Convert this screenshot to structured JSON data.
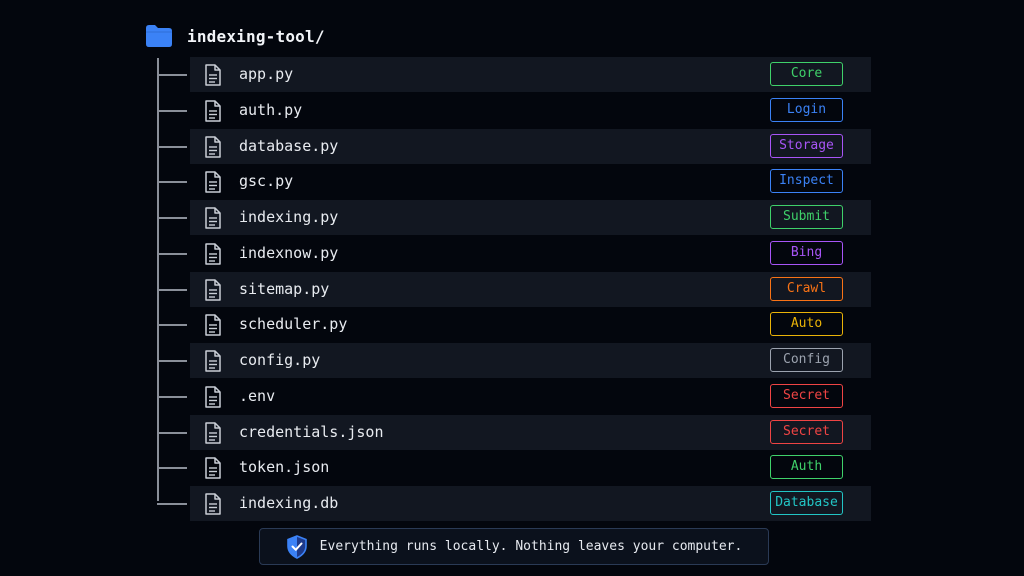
{
  "root": {
    "name": "indexing-tool/",
    "icon": "folder-icon"
  },
  "files": [
    {
      "name": "app.py",
      "tag": "Core",
      "color": "#3fd16a"
    },
    {
      "name": "auth.py",
      "tag": "Login",
      "color": "#3b82f6"
    },
    {
      "name": "database.py",
      "tag": "Storage",
      "color": "#a855f7"
    },
    {
      "name": "gsc.py",
      "tag": "Inspect",
      "color": "#3b82f6"
    },
    {
      "name": "indexing.py",
      "tag": "Submit",
      "color": "#3fd16a"
    },
    {
      "name": "indexnow.py",
      "tag": "Bing",
      "color": "#a855f7"
    },
    {
      "name": "sitemap.py",
      "tag": "Crawl",
      "color": "#f97316"
    },
    {
      "name": "scheduler.py",
      "tag": "Auto",
      "color": "#eab308"
    },
    {
      "name": "config.py",
      "tag": "Config",
      "color": "#9ca3af"
    },
    {
      "name": ".env",
      "tag": "Secret",
      "color": "#ef4444"
    },
    {
      "name": "credentials.json",
      "tag": "Secret",
      "color": "#ef4444"
    },
    {
      "name": "token.json",
      "tag": "Auth",
      "color": "#3fd16a"
    },
    {
      "name": "indexing.db",
      "tag": "Database",
      "color": "#22c5c5"
    }
  ],
  "footer": {
    "text": "Everything runs locally. Nothing leaves your computer.",
    "icon": "shield-check-icon",
    "accent": "#3b82f6"
  }
}
